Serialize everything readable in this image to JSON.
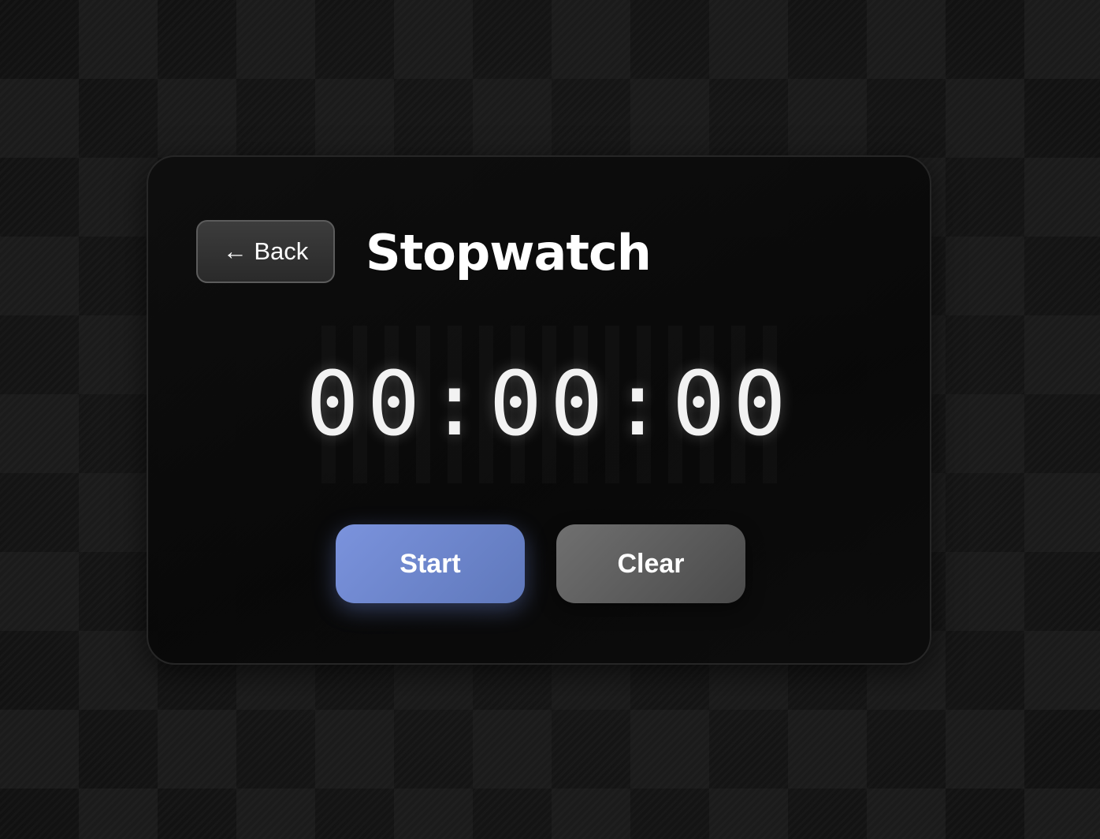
{
  "header": {
    "back_label": "← Back",
    "title": "Stopwatch"
  },
  "display": {
    "time": "00:00:00"
  },
  "controls": {
    "start_label": "Start",
    "clear_label": "Clear"
  },
  "colors": {
    "background": "#151515",
    "card": "#0b0b0b",
    "start_button": "#6f88cf",
    "clear_button": "#5e5e5e",
    "text": "#ffffff"
  }
}
